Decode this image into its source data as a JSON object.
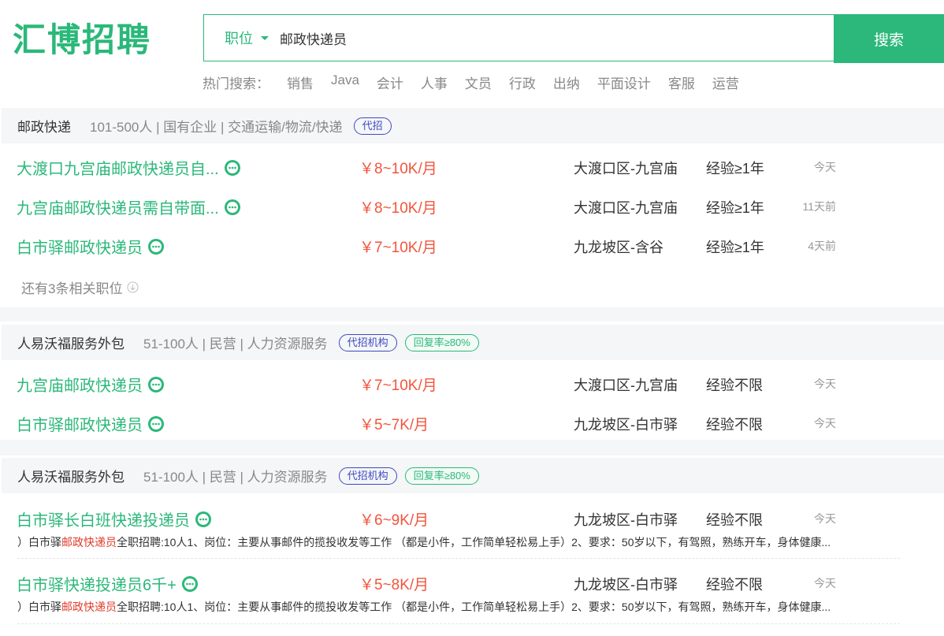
{
  "logo": "汇博招聘",
  "search": {
    "type_label": "职位",
    "value": "邮政快递员",
    "button": "搜索"
  },
  "hot": {
    "label": "热门搜索：",
    "items": [
      "销售",
      "Java",
      "会计",
      "人事",
      "文员",
      "行政",
      "出纳",
      "平面设计",
      "客服",
      "运营"
    ]
  },
  "companies": [
    {
      "name": "邮政快递",
      "meta": "101-500人 | 国有企业 | 交通运输/物流/快递",
      "tags": [
        "代招"
      ],
      "jobs": [
        {
          "title": "大渡口九宫庙邮政快递员自...",
          "salary": "￥8~10K/月",
          "location": "大渡口区-九宫庙",
          "exp": "经验≥1年",
          "time": "今天"
        },
        {
          "title": "九宫庙邮政快递员需自带面...",
          "salary": "￥8~10K/月",
          "location": "大渡口区-九宫庙",
          "exp": "经验≥1年",
          "time": "11天前"
        },
        {
          "title": "白市驿邮政快递员",
          "salary": "￥7~10K/月",
          "location": "九龙坡区-含谷",
          "exp": "经验≥1年",
          "time": "4天前"
        }
      ],
      "more": "还有3条相关职位"
    },
    {
      "name": "人易沃福服务外包",
      "meta": "51-100人 | 民营 | 人力资源服务",
      "tags": [
        "代招机构",
        "回复率≥80%"
      ],
      "jobs": [
        {
          "title": "九宫庙邮政快递员",
          "salary": "￥7~10K/月",
          "location": "大渡口区-九宫庙",
          "exp": "经验不限",
          "time": "今天"
        },
        {
          "title": "白市驿邮政快递员",
          "salary": "￥5~7K/月",
          "location": "九龙坡区-白市驿",
          "exp": "经验不限",
          "time": "今天"
        }
      ]
    },
    {
      "name": "人易沃福服务外包",
      "meta": "51-100人 | 民营 | 人力资源服务",
      "tags": [
        "代招机构",
        "回复率≥80%"
      ],
      "jobs": [
        {
          "title": "白市驿长白班快递投递员",
          "salary": "￥6~9K/月",
          "location": "九龙坡区-白市驿",
          "exp": "经验不限",
          "time": "今天",
          "desc": {
            "pre": "）白市驿",
            "kw": "邮政快递员",
            "post": "全职招聘:10人1、岗位：主要从事邮件的揽投收发等工作 （都是小件，工作简单轻松易上手）2、要求：50岁以下，有驾照，熟练开车，身体健康..."
          }
        },
        {
          "title": "白市驿快递投递员6千+",
          "salary": "￥5~8K/月",
          "location": "九龙坡区-白市驿",
          "exp": "经验不限",
          "time": "今天",
          "desc": {
            "pre": "）白市驿",
            "kw": "邮政快递员",
            "post": "全职招聘:10人1、岗位：主要从事邮件的揽投收发等工作 （都是小件，工作简单轻松易上手）2、要求：50岁以下，有驾照，熟练开车，身体健康..."
          }
        }
      ]
    }
  ]
}
